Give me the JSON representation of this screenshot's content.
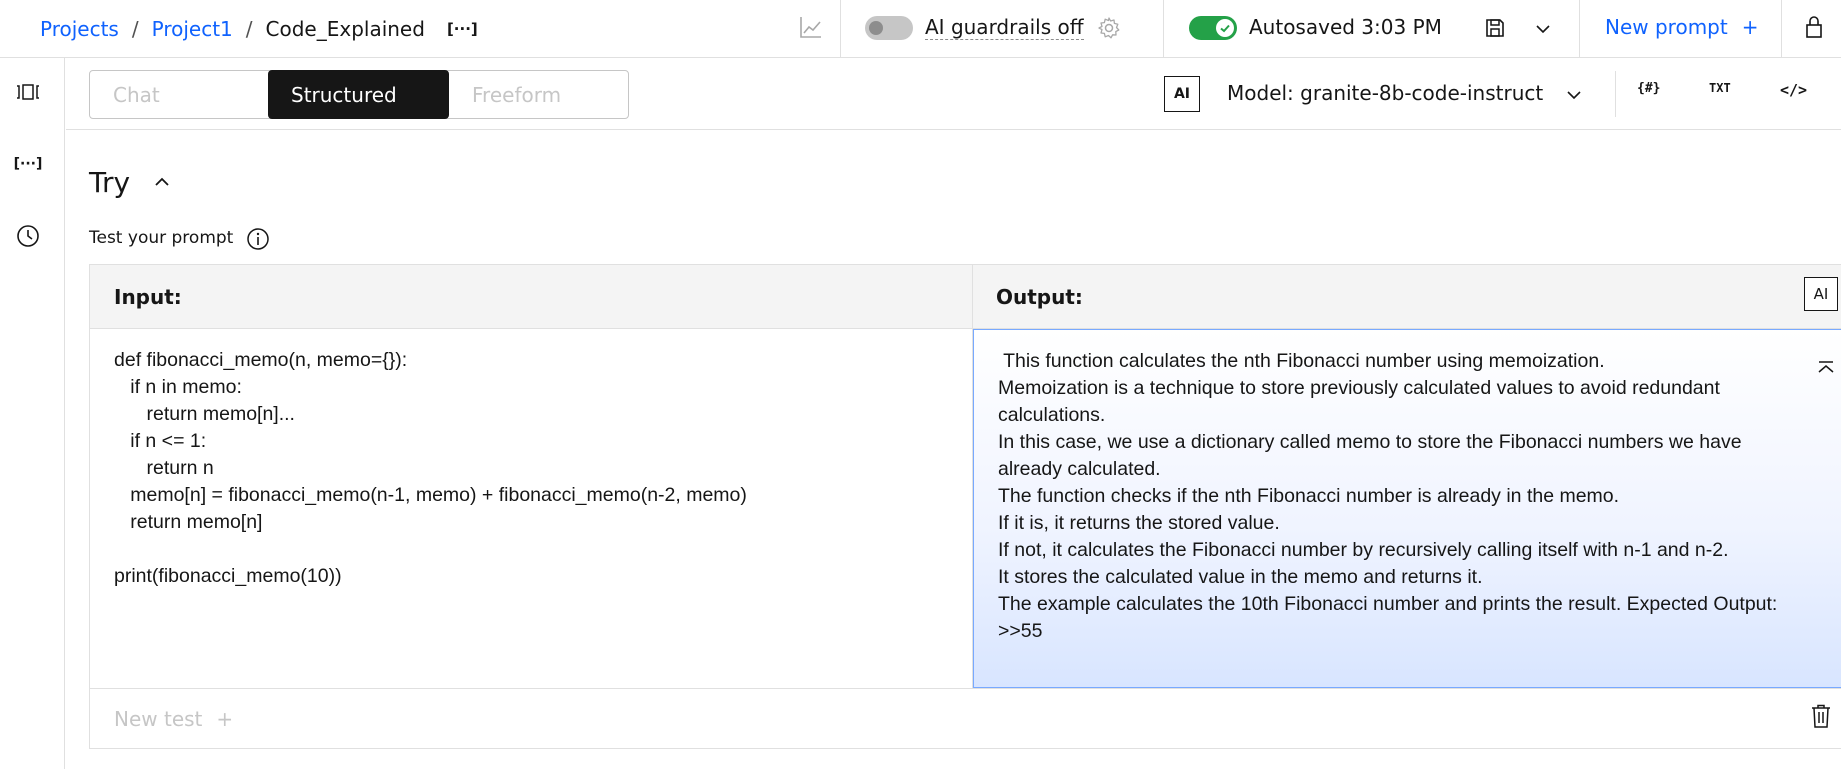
{
  "breadcrumb": {
    "items": [
      "Projects",
      "Project1"
    ],
    "separator": "/",
    "current": "Code_Explained",
    "more": "[···]"
  },
  "header": {
    "guardrails_label": "AI guardrails off",
    "guardrails_enabled": false,
    "autosave_label": "Autosaved 3:03 PM",
    "autosave_enabled": true,
    "new_prompt_label": "New prompt",
    "new_prompt_plus": "+"
  },
  "rail": {
    "icons": [
      "compare-icon",
      "variables-icon",
      "history-icon"
    ],
    "variables_label": "[···]"
  },
  "modes": {
    "tabs": [
      "Chat",
      "Structured",
      "Freeform"
    ],
    "selected": "Structured"
  },
  "model": {
    "badge": "AI",
    "label": "Model: granite-8b-code-instruct"
  },
  "toolbar_icons": {
    "tokens": "{#}",
    "txt": "TXT",
    "code": "</>"
  },
  "try": {
    "title": "Try",
    "test_label": "Test your prompt",
    "input_header": "Input:",
    "output_header": "Output:",
    "output_badge": "AI",
    "input_text": "def fibonacci_memo(n, memo={}):\n   if n in memo:\n      return memo[n]...\n   if n <= 1:\n      return n\n   memo[n] = fibonacci_memo(n-1, memo) + fibonacci_memo(n-2, memo)\n   return memo[n]\n\nprint(fibonacci_memo(10))",
    "output_lines": [
      " This function calculates the nth Fibonacci number using memoization.",
      "Memoization is a technique to store previously calculated values to avoid redundant calculations.",
      "In this case, we use a dictionary called memo to store the Fibonacci numbers we have already calculated.",
      "The function checks if the nth Fibonacci number is already in the memo.",
      "If it is, it returns the stored value.",
      "If not, it calculates the Fibonacci number by recursively calling itself with n-1 and n-2.",
      "It stores the calculated value in the memo and returns it.",
      "The example calculates the 10th Fibonacci number and prints the result. Expected Output: >>55"
    ],
    "new_test_label": "New test",
    "new_test_plus": "+"
  },
  "colors": {
    "link": "#0f62fe",
    "toggle_on": "#24a148",
    "toggle_off": "#c6c6c6",
    "selected_tab": "#161616",
    "output_border": "#78a9ff"
  }
}
